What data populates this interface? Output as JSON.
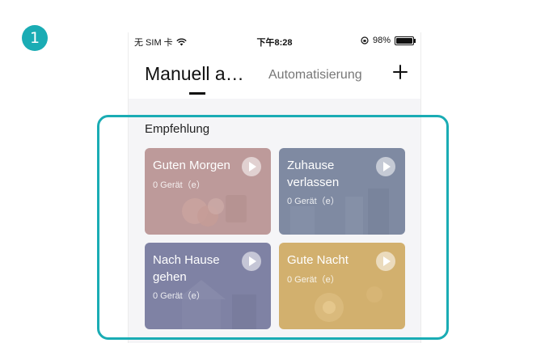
{
  "step_number": "1",
  "status_bar": {
    "carrier": "无 SIM 卡",
    "time": "下午8:28",
    "battery": "98%",
    "icons": [
      "wifi-icon",
      "orientation-lock-icon",
      "battery-icon"
    ]
  },
  "header": {
    "tab_manual": "Manuell a…",
    "tab_auto": "Automatisierung",
    "add_icon": "plus-icon"
  },
  "recommendation": {
    "title": "Empfehlung",
    "cards": [
      {
        "name": "Guten Morgen",
        "devices": "0  Gerät（e）",
        "color": "#bd9a9a"
      },
      {
        "name": "Zuhause verlassen",
        "devices": "0  Gerät（e）",
        "color": "#7f8aa2"
      },
      {
        "name": "Nach Hause gehen",
        "devices": "0  Gerät（e）",
        "color": "#7f82a4"
      },
      {
        "name": "Gute Nacht",
        "devices": "0  Gerät（e）",
        "color": "#d2b06e"
      }
    ]
  },
  "colors": {
    "accent": "#1aacb4"
  }
}
